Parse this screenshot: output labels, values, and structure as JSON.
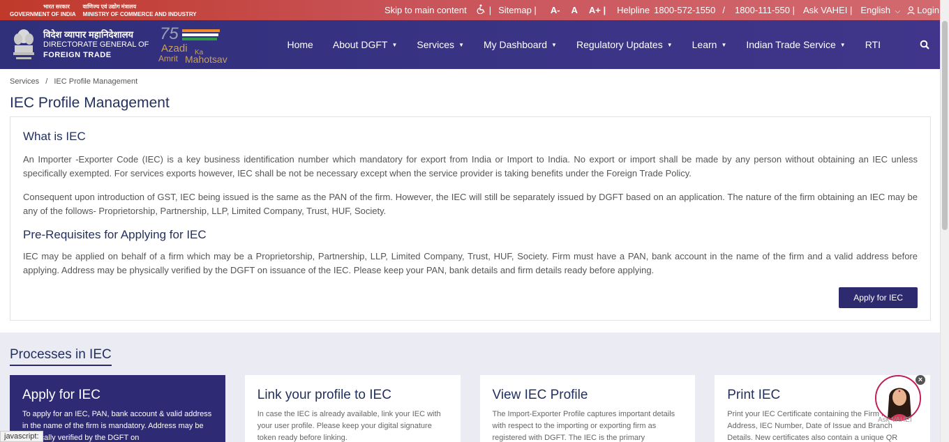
{
  "topbar": {
    "gov_hindi": "भारत सरकार",
    "gov_english": "GOVERNMENT OF INDIA",
    "ministry_hindi": "वाणिज्य एवं उद्योग मंत्रालय",
    "ministry_english": "MINISTRY OF COMMERCE AND INDUSTRY",
    "skip": "Skip to main content",
    "sitemap": "Sitemap |",
    "font_small": "A-",
    "font_normal": "A",
    "font_large": "A+ |",
    "helpline_label": "Helpline",
    "helpline_1": "1800-572-1550",
    "helpline_sep": "/",
    "helpline_2": "1800-111-550 |",
    "ask": "Ask VAHEI |",
    "language": "English",
    "login": "Login"
  },
  "brand": {
    "hindi": "विदेश व्यापार महानिदेशालय",
    "line1": "DIRECTORATE GENERAL OF",
    "line2": "FOREIGN TRADE",
    "azadi_1": "Azadi",
    "azadi_2": "Ka",
    "azadi_3": "Amrit",
    "azadi_4": "Mahotsav",
    "azadi_75": "75"
  },
  "nav": {
    "items": [
      {
        "label": "Home",
        "dropdown": false
      },
      {
        "label": "About DGFT",
        "dropdown": true
      },
      {
        "label": "Services",
        "dropdown": true
      },
      {
        "label": "My Dashboard",
        "dropdown": true
      },
      {
        "label": "Regulatory Updates",
        "dropdown": true
      },
      {
        "label": "Learn",
        "dropdown": true
      },
      {
        "label": "Indian Trade Service",
        "dropdown": true
      },
      {
        "label": "RTI",
        "dropdown": false
      }
    ]
  },
  "breadcrumb": {
    "items": [
      "Services",
      "IEC Profile Management"
    ],
    "separator": "/"
  },
  "page": {
    "title": "IEC Profile Management"
  },
  "info": {
    "heading1": "What is IEC",
    "para1": "An Importer -Exporter Code (IEC) is a key business identification number which mandatory for export from India or Import to India. No export or import shall be made by any person without obtaining an IEC unless specifically exempted. For services exports however, IEC shall be not be necessary except when the service provider is taking benefits under the Foreign Trade Policy.",
    "para2": "Consequent upon introduction of GST, IEC being issued is the same as the PAN of the firm. However, the IEC will still be separately issued by DGFT based on an application. The nature of the firm obtaining an IEC may be any of the follows- Proprietorship, Partnership, LLP, Limited Company, Trust, HUF, Society.",
    "heading2": "Pre-Requisites for Applying for IEC",
    "para3": "IEC may be applied on behalf of a firm which may be a Proprietorship, Partnership, LLP, Limited Company, Trust, HUF, Society. Firm must have a PAN, bank account in the name of the firm and a valid address before applying. Address may be physically verified by the DGFT on issuance of the IEC. Please keep your PAN, bank details and firm details ready before applying.",
    "apply_button": "Apply for IEC"
  },
  "processes": {
    "heading": "Processes in IEC",
    "cards": [
      {
        "title": "Apply for IEC",
        "text": "To apply for an IEC, PAN, bank account & valid address in the name of the firm is mandatory. Address may be physically verified by the DGFT on"
      },
      {
        "title": "Link your profile to IEC",
        "text": "In case the IEC is already available, link your IEC with your user profile. Please keep your digital signature token ready before linking."
      },
      {
        "title": "View IEC Profile",
        "text": "The Import-Exporter Profile captures important details with respect to the importing or exporting firm as registered with DGFT. The IEC is the primary"
      },
      {
        "title": "Print IEC",
        "text": "Print your IEC Certificate containing the Firm Name, Address, IEC Number, Date of Issue and Branch Details. New certificates also contain a unique QR"
      }
    ]
  },
  "chat": {
    "label": "Ask VAHEI",
    "close": "×"
  },
  "status_bar": "javascript:",
  "colors": {
    "topbar": "#c9545a",
    "navbar": "#3b3486",
    "accent": "#2d2a70",
    "title": "#22305e"
  }
}
